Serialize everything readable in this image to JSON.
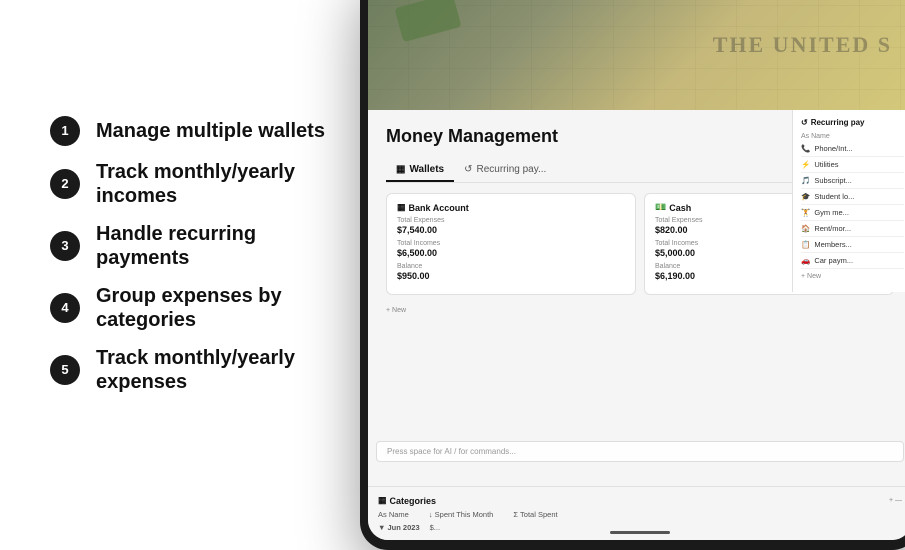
{
  "background": "#ffffff",
  "features": [
    {
      "number": "1",
      "text": "Manage multiple wallets"
    },
    {
      "number": "2",
      "text": "Track monthly/yearly incomes"
    },
    {
      "number": "3",
      "text": "Handle recurring payments"
    },
    {
      "number": "4",
      "text": "Group expenses by categories"
    },
    {
      "number": "5",
      "text": "Track monthly/yearly expenses"
    }
  ],
  "app": {
    "title": "Money Management",
    "tabs": [
      "Wallets",
      "Recurring pay..."
    ],
    "active_tab": "Wallets",
    "wallets": [
      {
        "name": "Bank Account",
        "total_expenses_label": "Total Expenses",
        "total_expenses_value": "$7,540.00",
        "total_incomes_label": "Total Incomes",
        "total_incomes_value": "$6,500.00",
        "balance_label": "Balance",
        "balance_value": "$950.00"
      },
      {
        "name": "Cash",
        "total_expenses_label": "Total Expenses",
        "total_expenses_value": "$820.00",
        "total_incomes_label": "Total Incomes",
        "total_incomes_value": "$5,000.00",
        "balance_label": "Balance",
        "balance_value": "$6,190.00"
      }
    ],
    "new_wallet": "+ New",
    "recurring_title": "Recurring pay",
    "recurring_col_label": "As Name",
    "recurring_items": [
      {
        "icon": "📞",
        "name": "Phone/Int..."
      },
      {
        "icon": "⚡",
        "name": "Utilities"
      },
      {
        "icon": "🎵",
        "name": "Subscript..."
      },
      {
        "icon": "🎓",
        "name": "Student lo..."
      },
      {
        "icon": "🏋️",
        "name": "Gym me..."
      },
      {
        "icon": "🏠",
        "name": "Rent/mor..."
      },
      {
        "icon": "📋",
        "name": "Members..."
      },
      {
        "icon": "🚗",
        "name": "Car paym..."
      }
    ],
    "recurring_new": "+ New",
    "press_space": "Press space for AI  /  for commands...",
    "categories_title": "Categories",
    "categories_col_as_name": "As Name",
    "categories_col_spent_month": "↓ Spent This Month",
    "categories_col_total_spent": "Σ Total Spent",
    "categories_month": "▼  Jun 2023",
    "categories_amount": "$..."
  }
}
